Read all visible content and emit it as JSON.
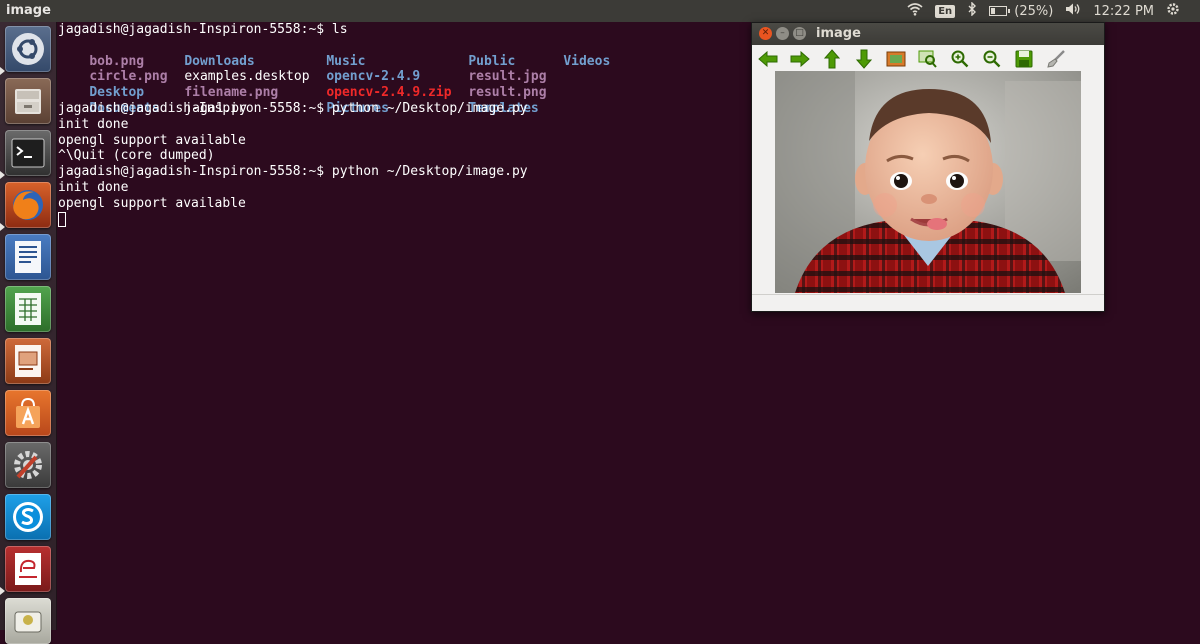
{
  "topbar": {
    "window_title": "image",
    "keyboard_layout": "En",
    "battery": "(25%)",
    "clock": "12:22 PM"
  },
  "launcher": {
    "items": [
      {
        "name": "Dash"
      },
      {
        "name": "Files"
      },
      {
        "name": "Terminal"
      },
      {
        "name": "Firefox"
      },
      {
        "name": "LibreOffice Writer"
      },
      {
        "name": "LibreOffice Calc"
      },
      {
        "name": "LibreOffice Impress"
      },
      {
        "name": "Ubuntu Software Center"
      },
      {
        "name": "System Settings"
      },
      {
        "name": "Skype"
      },
      {
        "name": "Document Viewer"
      },
      {
        "name": "Removable Drive"
      }
    ]
  },
  "terminal": {
    "prompt1": "jagadish@jagadish-Inspiron-5558:~$ ls",
    "ls": {
      "col1": [
        "bob.png",
        "circle.png",
        "Desktop",
        "Documents"
      ],
      "col2": [
        "Downloads",
        "examples.desktop",
        "filename.png",
        "jaga1.py"
      ],
      "col3": [
        "Music",
        "opencv-2.4.9",
        "opencv-2.4.9.zip",
        "Pictures"
      ],
      "col4": [
        "Public",
        "result.jpg",
        "result.png",
        "Templates"
      ],
      "col5": [
        "Videos"
      ]
    },
    "cmd2": "jagadish@jagadish-Inspiron-5558:~$ python ~/Desktop/image.py",
    "out2a": "init done",
    "out2b": "opengl support available",
    "out2c": "^\\Quit (core dumped)",
    "cmd3": "jagadish@jagadish-Inspiron-5558:~$ python ~/Desktop/image.py",
    "out3a": "init done",
    "out3b": "opengl support available"
  },
  "image_window": {
    "title": "image",
    "toolbar": [
      "pan-left",
      "pan-right",
      "pan-up",
      "pan-down",
      "zoom-original",
      "zoom-fit",
      "zoom-in",
      "zoom-out",
      "save",
      "properties"
    ]
  },
  "colors": {
    "terminal_bg": "#2c0a1e",
    "dir": "#729fcf",
    "image_file": "#ad7fa8",
    "archive": "#ef2929",
    "close_button": "#e95420"
  }
}
